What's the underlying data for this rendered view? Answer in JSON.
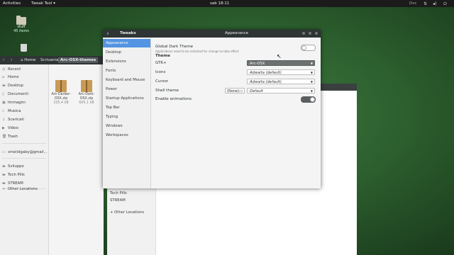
{
  "topbar": {
    "activities": "Activities",
    "app_menu": "Tweak Tool",
    "clock": "sab 18:11",
    "right_label": "Dvc"
  },
  "desktop": {
    "icons": [
      {
        "label": "stuff",
        "sub": "45 items"
      }
    ]
  },
  "files": {
    "back_icon": "chevron-left-icon",
    "forward_icon": "chevron-right-icon",
    "breadcrumb": [
      "Home",
      "Scrivania",
      "Arc-OSX-themes"
    ],
    "sidebar": [
      {
        "icon": "clock-icon",
        "label": "Recent"
      },
      {
        "icon": "home-icon",
        "label": "Home"
      },
      {
        "icon": "folder-icon",
        "label": "Desktop"
      },
      {
        "icon": "document-icon",
        "label": "Documenti"
      },
      {
        "icon": "image-icon",
        "label": "Immagini"
      },
      {
        "icon": "music-icon",
        "label": "Musica"
      },
      {
        "icon": "download-icon",
        "label": "Scaricati"
      },
      {
        "icon": "video-icon",
        "label": "Video"
      },
      {
        "icon": "trash-icon",
        "label": "Trash"
      },
      {
        "icon": "drive-icon",
        "label": "smelidgaby@gmail..."
      },
      {
        "icon": "folder-icon",
        "label": "Sviluppo"
      },
      {
        "icon": "folder-icon",
        "label": "Tech Pills"
      },
      {
        "icon": "folder-icon",
        "label": "STREAM"
      },
      {
        "icon": "plus-icon",
        "label": "Other Locations"
      }
    ],
    "items": [
      {
        "name": "Arc-Darker-OSX.zip",
        "size": "335,4 kB"
      },
      {
        "name": "Arc-Dark-OSX.zip",
        "size": "605,1 kB"
      }
    ]
  },
  "back_window": {
    "sidebar_items": [
      "Tech Pills",
      "STREAM",
      "Other Locations"
    ]
  },
  "tweak": {
    "title": "Tweaks",
    "panel_title": "Appearance",
    "nav": [
      "Appearance",
      "Desktop",
      "Extensions",
      "Fonts",
      "Keyboard and Mouse",
      "Power",
      "Startup Applications",
      "Top Bar",
      "Typing",
      "Windows",
      "Workspaces"
    ],
    "selected_nav": "Appearance",
    "global_dark_label": "Global Dark Theme",
    "global_dark_hint": "Applications need to be restarted for change to take effect",
    "global_dark_on": false,
    "theme_section": "Theme",
    "rows": [
      {
        "label": "GTK+",
        "value": "Arc-OSX"
      },
      {
        "label": "Icons",
        "value": "Adwaita (default)"
      },
      {
        "label": "Cursor",
        "value": "Adwaita (default)"
      },
      {
        "label": "Shell theme",
        "value": "Default",
        "extra": "(None)"
      }
    ],
    "animations_label": "Enable animations",
    "animations_on": true
  },
  "colors": {
    "accent": "#5294e2"
  }
}
